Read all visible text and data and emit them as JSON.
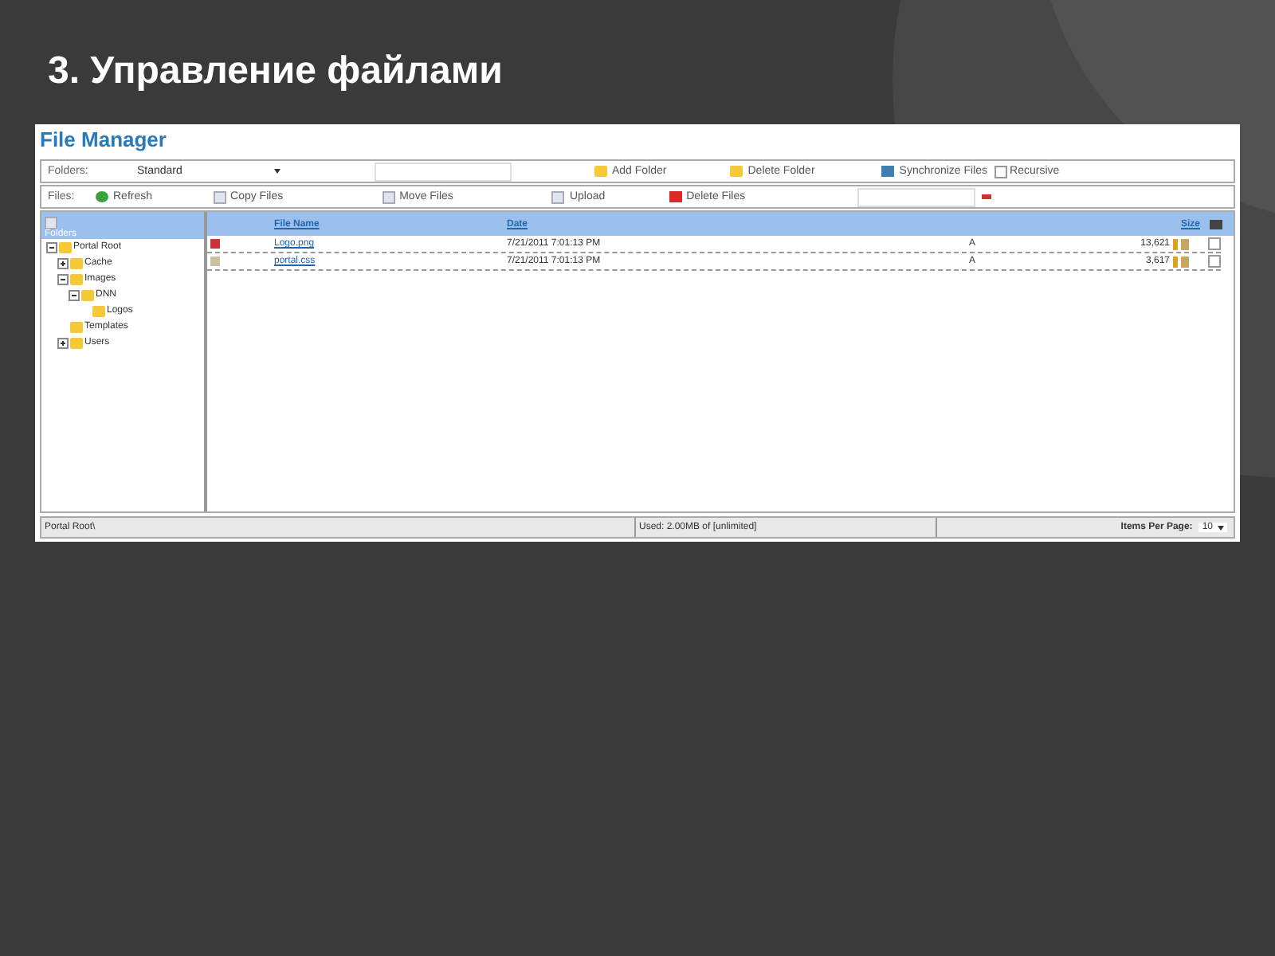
{
  "slide_title": "3. Управление файлами",
  "app_title": "File Manager",
  "folders_bar": {
    "label": "Folders:",
    "dropdown_value": "Standard",
    "add_folder": "Add Folder",
    "delete_folder": "Delete Folder",
    "synchronize": "Synchronize Files",
    "recursive": {
      "label": "Recursive",
      "checked": false
    }
  },
  "files_bar": {
    "label": "Files:",
    "refresh": "Refresh",
    "copy": "Copy Files",
    "move": "Move Files",
    "upload": "Upload",
    "delete": "Delete Files"
  },
  "tree": {
    "header": "Folders",
    "items": [
      {
        "label": "Portal Root",
        "expanded": true,
        "children": [
          {
            "label": "Cache",
            "expanded": false
          },
          {
            "label": "Images",
            "expanded": true,
            "children": [
              {
                "label": "DNN",
                "expanded": true,
                "children": [
                  {
                    "label": "Logos"
                  }
                ]
              }
            ]
          },
          {
            "label": "Templates"
          },
          {
            "label": "Users",
            "expanded": false
          }
        ]
      }
    ]
  },
  "table": {
    "columns": [
      "File Name",
      "Date",
      "Size"
    ],
    "rows": [
      {
        "kind": "image",
        "name": "Logo.png",
        "date": "7/21/2011 7:01:13 PM",
        "attr": "A",
        "size": "13,621",
        "checked": false
      },
      {
        "kind": "text",
        "name": "portal.css",
        "date": "7/21/2011 7:01:13 PM",
        "attr": "A",
        "size": "3,617",
        "checked": false
      }
    ]
  },
  "status_bar": {
    "path": "Portal Root\\",
    "used": "Used: 2.00MB of [unlimited]",
    "items_per_page_label": "Items Per Page:",
    "items_per_page": "10"
  }
}
